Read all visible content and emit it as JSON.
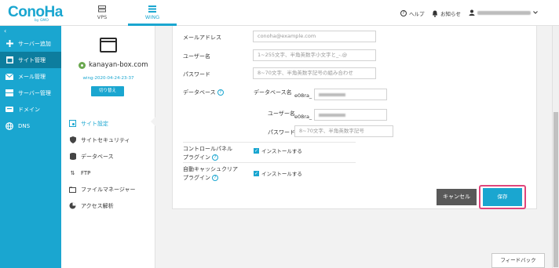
{
  "header": {
    "logo_text": "ConoHa",
    "logo_byline": "by GMO",
    "tabs": [
      {
        "label": "VPS",
        "icon": "server-icon"
      },
      {
        "label": "WING",
        "icon": "wing-icon"
      }
    ],
    "help_label": "ヘルプ",
    "notice_label": "お知らせ",
    "accent": "#1aa6d0"
  },
  "sidebar": {
    "collapse": "‹",
    "items": [
      {
        "label": "サーバー追加",
        "icon": "plus-icon"
      },
      {
        "label": "サイト管理",
        "icon": "site-icon"
      },
      {
        "label": "メール管理",
        "icon": "mail-icon"
      },
      {
        "label": "サーバー管理",
        "icon": "server-icon"
      },
      {
        "label": "ドメイン",
        "icon": "domain-icon"
      },
      {
        "label": "DNS",
        "icon": "globe-icon"
      }
    ]
  },
  "site": {
    "name": "kanayan-box.com",
    "id": "wing-2020-04-24-23-37",
    "switch_label": "切り替え"
  },
  "subnav": [
    {
      "label": "サイト設定",
      "icon": "site-settings-icon"
    },
    {
      "label": "サイトセキュリティ",
      "icon": "shield-icon"
    },
    {
      "label": "データベース",
      "icon": "database-icon"
    },
    {
      "label": "FTP",
      "icon": "ftp-icon"
    },
    {
      "label": "ファイルマネージャー",
      "icon": "folder-icon"
    },
    {
      "label": "アクセス解析",
      "icon": "pie-chart-icon"
    }
  ],
  "form": {
    "email_label": "メールアドレス",
    "email_placeholder": "conoha@example.com",
    "username_label": "ユーザー名",
    "username_placeholder": "1~255文字、半角英数字小文字と_-.@",
    "password_label": "パスワード",
    "password_placeholder": "8~70文字、半角英数字記号の組み合わせ",
    "database_label": "データベース",
    "db_name_label": "データベース名",
    "db_name_prefix": "e08ra_",
    "db_user_label": "ユーザー名",
    "db_user_prefix": "e08ra_",
    "db_password_label": "パスワード",
    "db_password_placeholder": "8~70文字、半角英数字記号",
    "control_panel_label_1": "コントロールパネル",
    "control_panel_label_2": "プラグイン",
    "control_panel_check": "インストールする",
    "autocache_label_1": "自動キャッシュクリア",
    "autocache_label_2": "プラグイン",
    "autocache_check": "インストールする"
  },
  "actions": {
    "cancel_label": "キャンセル",
    "save_label": "保存"
  },
  "feedback_label": "フィードバック"
}
